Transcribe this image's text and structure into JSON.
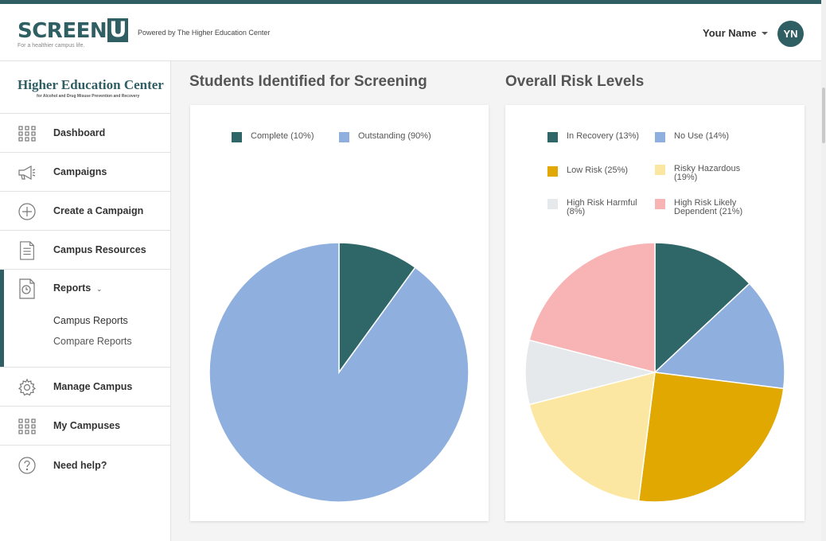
{
  "header": {
    "logo_text": "SCREEN",
    "logo_u": "U",
    "logo_tagline": "For a healthier campus life.",
    "powered_by": "Powered by The Higher Education Center",
    "user_name": "Your Name",
    "avatar_initials": "YN"
  },
  "sidebar": {
    "org_title": "Higher Education Center",
    "org_subtitle": "for Alcohol and Drug Misuse Prevention and Recovery",
    "items": [
      {
        "label": "Dashboard",
        "icon": "grid-icon"
      },
      {
        "label": "Campaigns",
        "icon": "megaphone-icon"
      },
      {
        "label": "Create a Campaign",
        "icon": "plus-circle-icon"
      },
      {
        "label": "Campus Resources",
        "icon": "document-icon"
      },
      {
        "label": "Reports",
        "icon": "clock-document-icon"
      },
      {
        "label": "Manage Campus",
        "icon": "gear-icon"
      },
      {
        "label": "My Campuses",
        "icon": "grid-icon"
      },
      {
        "label": "Need help?",
        "icon": "question-circle-icon"
      }
    ],
    "reports_sub": [
      "Campus Reports",
      "Compare Reports"
    ]
  },
  "main": {
    "screening_title": "Students Identified for Screening",
    "risk_title": "Overall Risk Levels"
  },
  "colors": {
    "brand": "#2f5f63",
    "outstanding": "#8fb0de",
    "low_risk": "#e0a800",
    "risky": "#fbe7a1",
    "high_harmful": "#e6e9eb",
    "high_dependent": "#f8b4b4"
  },
  "chart_data": [
    {
      "type": "pie",
      "title": "Students Identified for Screening",
      "legend_position": "top",
      "series": [
        {
          "name": "Complete (10%)",
          "value": 10,
          "color": "#2f6668"
        },
        {
          "name": "Outstanding (90%)",
          "value": 90,
          "color": "#8fb0de"
        }
      ]
    },
    {
      "type": "pie",
      "title": "Overall Risk Levels",
      "legend_position": "top",
      "series": [
        {
          "name": "In Recovery (13%)",
          "value": 13,
          "color": "#2f6668"
        },
        {
          "name": "No Use (14%)",
          "value": 14,
          "color": "#8fb0de"
        },
        {
          "name": "Low Risk (25%)",
          "value": 25,
          "color": "#e0a800"
        },
        {
          "name": "Risky Hazardous (19%)",
          "value": 19,
          "color": "#fbe7a1"
        },
        {
          "name": "High Risk Harmful (8%)",
          "value": 8,
          "color": "#e6e9eb"
        },
        {
          "name": "High Risk Likely Dependent (21%)",
          "value": 21,
          "color": "#f8b4b4"
        }
      ]
    }
  ]
}
